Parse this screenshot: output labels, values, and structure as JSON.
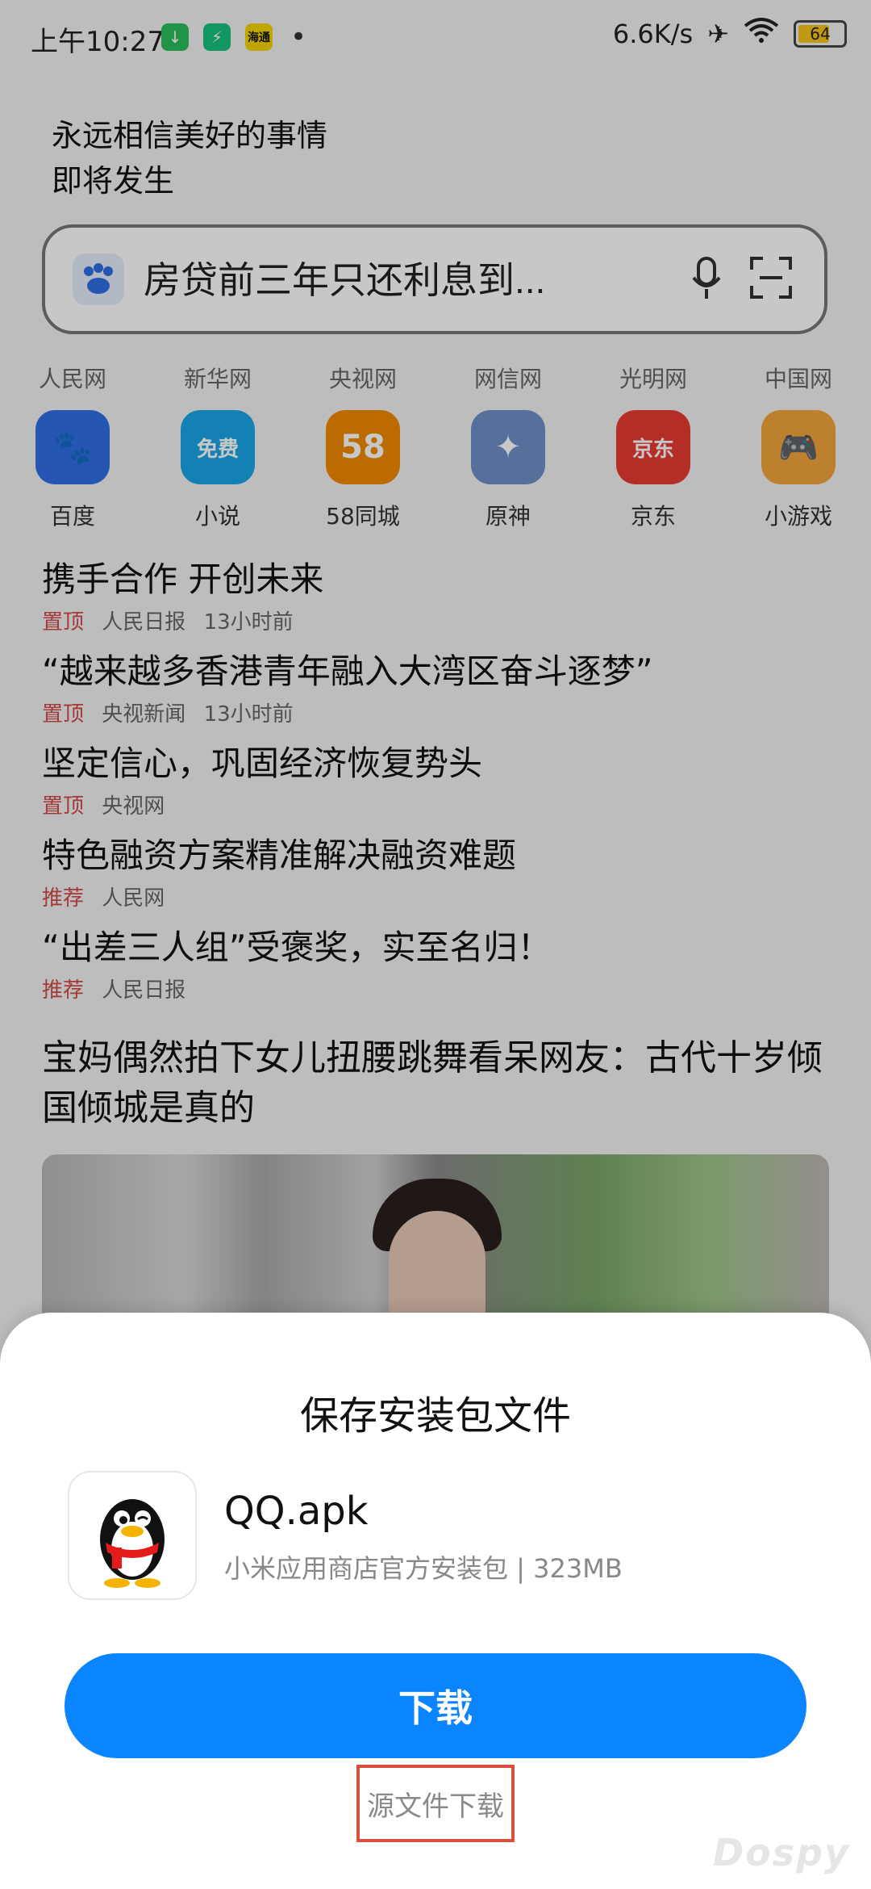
{
  "status": {
    "time": "上午10:27",
    "speed": "6.6K/s",
    "battery": "64",
    "dot": "•",
    "icon_yellow_text": "海通"
  },
  "slogan": {
    "line1": "永远相信美好的事情",
    "line2": "即将发生"
  },
  "search": {
    "placeholder": "房贷前三年只还利息到..."
  },
  "quick_links": [
    "人民网",
    "新华网",
    "央视网",
    "网信网",
    "光明网",
    "中国网"
  ],
  "apps": [
    {
      "label": "百度",
      "color": "#2f6fe4",
      "glyph": "🐾"
    },
    {
      "label": "小说",
      "color": "#1aa6e8",
      "glyph": "免费"
    },
    {
      "label": "58同城",
      "color": "#f08a00",
      "glyph": "58"
    },
    {
      "label": "原神",
      "color": "#6f8fc7",
      "glyph": "✦"
    },
    {
      "label": "京东",
      "color": "#e73b32",
      "glyph": "京东"
    },
    {
      "label": "小游戏",
      "color": "#f3a43c",
      "glyph": "🎮"
    }
  ],
  "news": [
    {
      "title": "携手合作 开创未来",
      "tag": "置顶",
      "source": "人民日报",
      "time": "13小时前"
    },
    {
      "title": "“越来越多香港青年融入大湾区奋斗逐梦”",
      "tag": "置顶",
      "source": "央视新闻",
      "time": "13小时前"
    },
    {
      "title": "坚定信心，巩固经济恢复势头",
      "tag": "置顶",
      "source": "央视网",
      "time": ""
    },
    {
      "title": "特色融资方案精准解决融资难题",
      "tag": "推荐",
      "source": "人民网",
      "time": ""
    },
    {
      "title": "“出差三人组”受褒奖，实至名归！",
      "tag": "推荐",
      "source": "人民日报",
      "time": ""
    }
  ],
  "feature": {
    "title": "宝妈偶然拍下女儿扭腰跳舞看呆网友：古代十岁倾国倾城是真的"
  },
  "sheet": {
    "title": "保存安装包文件",
    "file_name": "QQ.apk",
    "file_desc": "小米应用商店官方安装包 | 323MB",
    "download_label": "下载",
    "source_label": "源文件下载"
  },
  "watermark": "Dospy"
}
